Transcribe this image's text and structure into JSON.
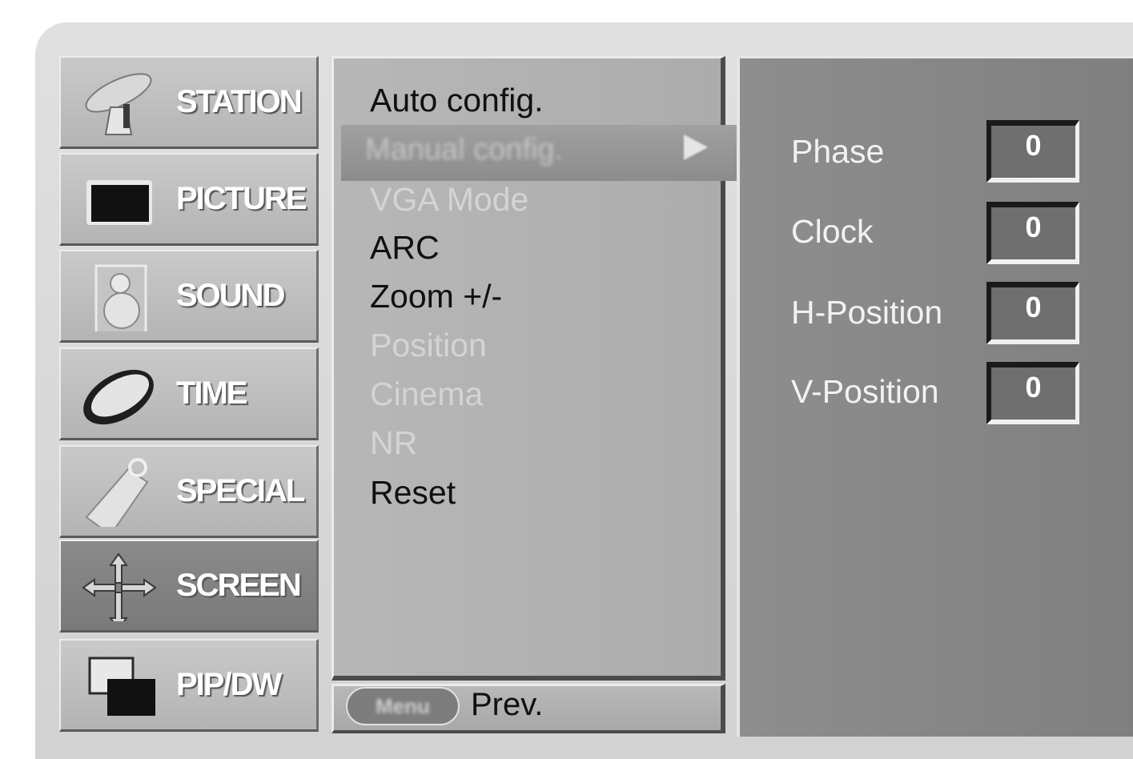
{
  "categories": [
    {
      "label": "STATION",
      "icon": "satellite-dish-icon"
    },
    {
      "label": "PICTURE",
      "icon": "tv-screen-icon"
    },
    {
      "label": "SOUND",
      "icon": "speaker-icon"
    },
    {
      "label": "TIME",
      "icon": "clock-icon"
    },
    {
      "label": "SPECIAL",
      "icon": "tag-icon"
    },
    {
      "label": "SCREEN",
      "icon": "move-arrows-icon"
    },
    {
      "label": "PIP/DW",
      "icon": "pip-windows-icon"
    }
  ],
  "active_category": "SCREEN",
  "menu": {
    "items": [
      {
        "label": "Auto config.",
        "state": "enabled"
      },
      {
        "label": "Manual config.",
        "state": "selected"
      },
      {
        "label": "VGA Mode",
        "state": "disabled"
      },
      {
        "label": "ARC",
        "state": "enabled"
      },
      {
        "label": "Zoom +/-",
        "state": "enabled"
      },
      {
        "label": "Position",
        "state": "disabled"
      },
      {
        "label": "Cinema",
        "state": "disabled"
      },
      {
        "label": "NR",
        "state": "disabled"
      },
      {
        "label": "Reset",
        "state": "enabled"
      }
    ]
  },
  "footer": {
    "key_label": "Menu",
    "prev_label": "Prev."
  },
  "manual_config": {
    "params": [
      {
        "label": "Phase",
        "value": "0"
      },
      {
        "label": "Clock",
        "value": "0"
      },
      {
        "label": "H-Position",
        "value": "0"
      },
      {
        "label": "V-Position",
        "value": "0"
      }
    ]
  }
}
